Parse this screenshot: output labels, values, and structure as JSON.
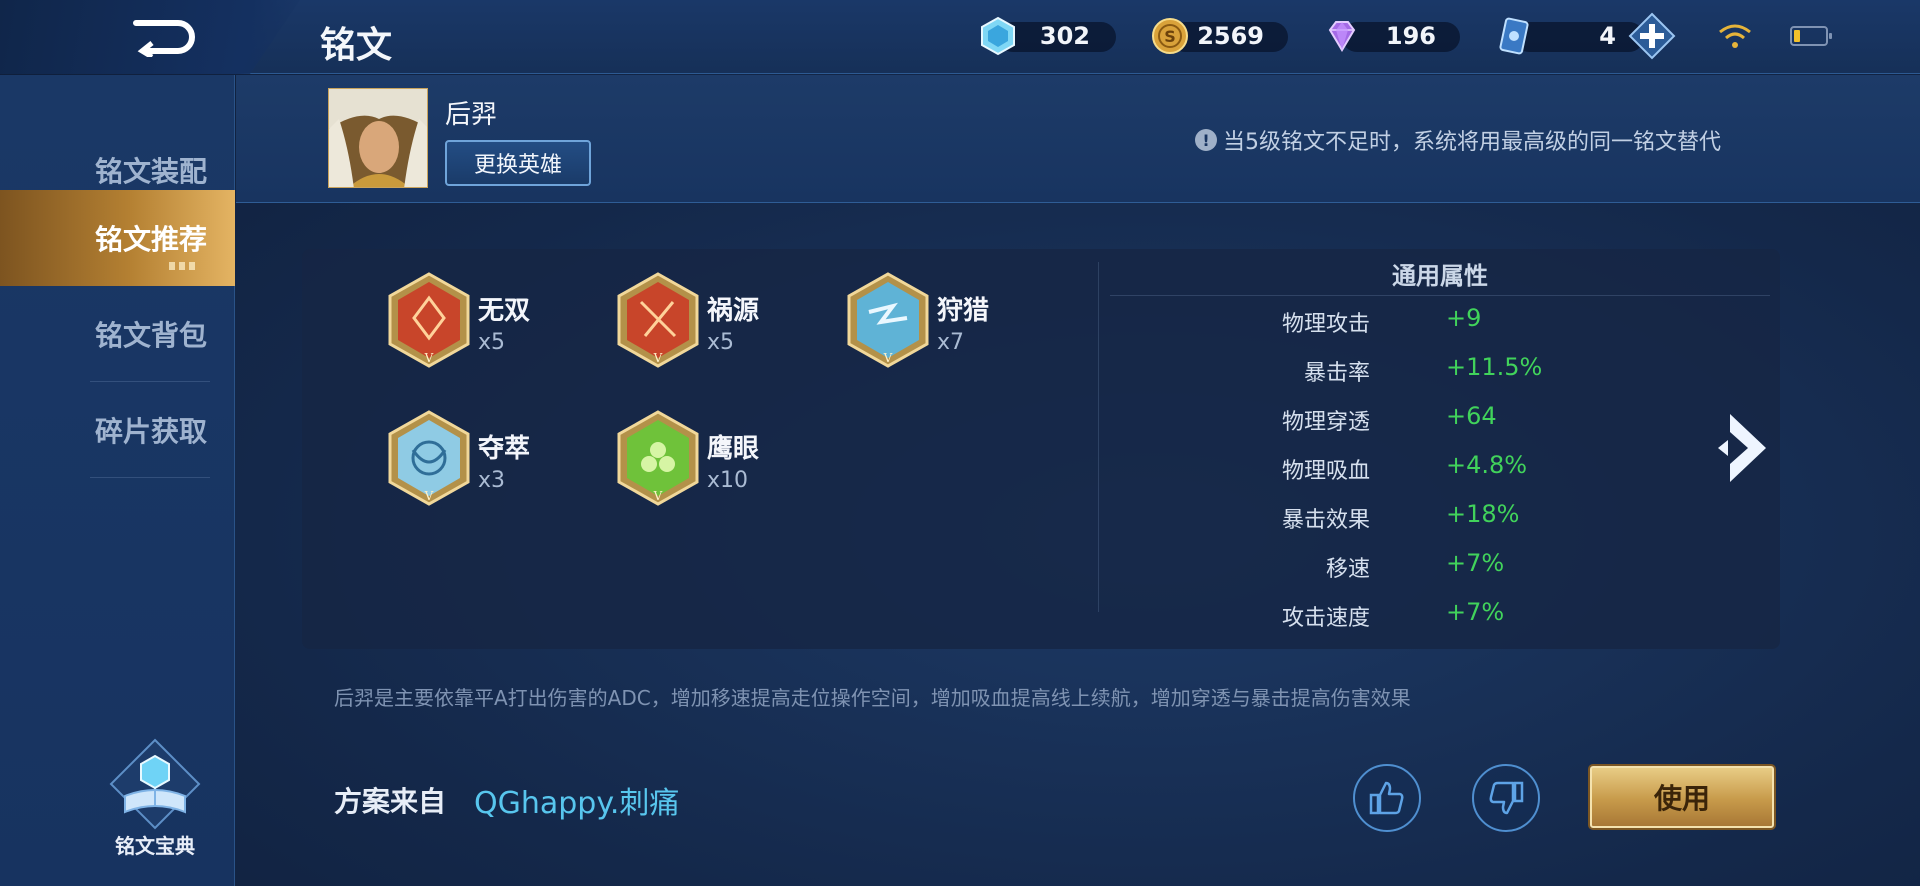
{
  "header": {
    "title": "铭文",
    "resources": [
      {
        "icon": "crystal-icon",
        "value": "302"
      },
      {
        "icon": "gold-coin-icon",
        "value": "2569"
      },
      {
        "icon": "diamond-icon",
        "value": "196"
      },
      {
        "icon": "ticket-card-icon",
        "value": "4"
      }
    ]
  },
  "sidebar": {
    "items": [
      {
        "label": "铭文装配",
        "active": false
      },
      {
        "label": "铭文推荐",
        "active": true
      },
      {
        "label": "铭文背包",
        "active": false
      },
      {
        "label": "碎片获取",
        "active": false
      }
    ],
    "codex_label": "铭文宝典"
  },
  "hero": {
    "name": "后羿",
    "change_label": "更换英雄",
    "tip_icon": "!",
    "tip": "当5级铭文不足时，系统将用最高级的同一铭文替代"
  },
  "runes": [
    {
      "name": "无双",
      "count": "x5",
      "color": "#c8452a"
    },
    {
      "name": "祸源",
      "count": "x5",
      "color": "#c8452a"
    },
    {
      "name": "狩猎",
      "count": "x7",
      "color": "#5fb3d6"
    },
    {
      "name": "夺萃",
      "count": "x3",
      "color": "#5fb3d6"
    },
    {
      "name": "鹰眼",
      "count": "x10",
      "color": "#6fc23a"
    }
  ],
  "attributes": {
    "title": "通用属性",
    "rows": [
      {
        "key": "物理攻击",
        "value": "+9"
      },
      {
        "key": "暴击率",
        "value": "+11.5%"
      },
      {
        "key": "物理穿透",
        "value": "+64"
      },
      {
        "key": "物理吸血",
        "value": "+4.8%"
      },
      {
        "key": "暴击效果",
        "value": "+18%"
      },
      {
        "key": "移速",
        "value": "+7%"
      },
      {
        "key": "攻击速度",
        "value": "+7%"
      }
    ]
  },
  "description": "后羿是主要依靠平A打出伤害的ADC，增加移速提高走位操作空间，增加吸血提高线上续航，增加穿透与暴击提高伤害效果",
  "footer": {
    "source_label": "方案来自",
    "source_name": "QGhappy.刺痛",
    "use_label": "使用"
  },
  "colors": {
    "accent_gold": "#c79a4a",
    "positive_green": "#41d35b",
    "link_blue": "#58c6ee"
  }
}
